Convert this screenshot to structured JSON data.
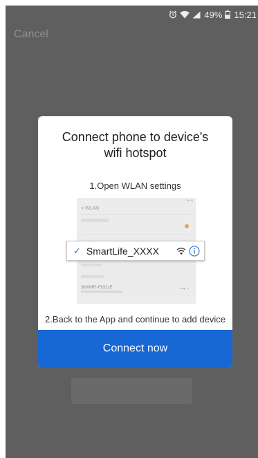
{
  "status_bar": {
    "battery": "49%",
    "time": "15:21",
    "icons": [
      "alarm-icon",
      "wifi-icon",
      "signal-icon",
      "battery-icon"
    ]
  },
  "header": {
    "cancel_label": "Cancel"
  },
  "modal": {
    "title": "Connect phone to device's wifi hotspot",
    "step1": "1.Open WLAN settings",
    "step2": "2.Back to the App and continue to add device",
    "connect_label": "Connect now",
    "illustration": {
      "nav_title": "< WLAN",
      "selected_ssid": "SmartLife_XXXX",
      "other_network": "360WIFI-F9321E"
    }
  },
  "colors": {
    "overlay": "#5f5f5f",
    "primary": "#1767d4",
    "check": "#2f6fd6"
  }
}
